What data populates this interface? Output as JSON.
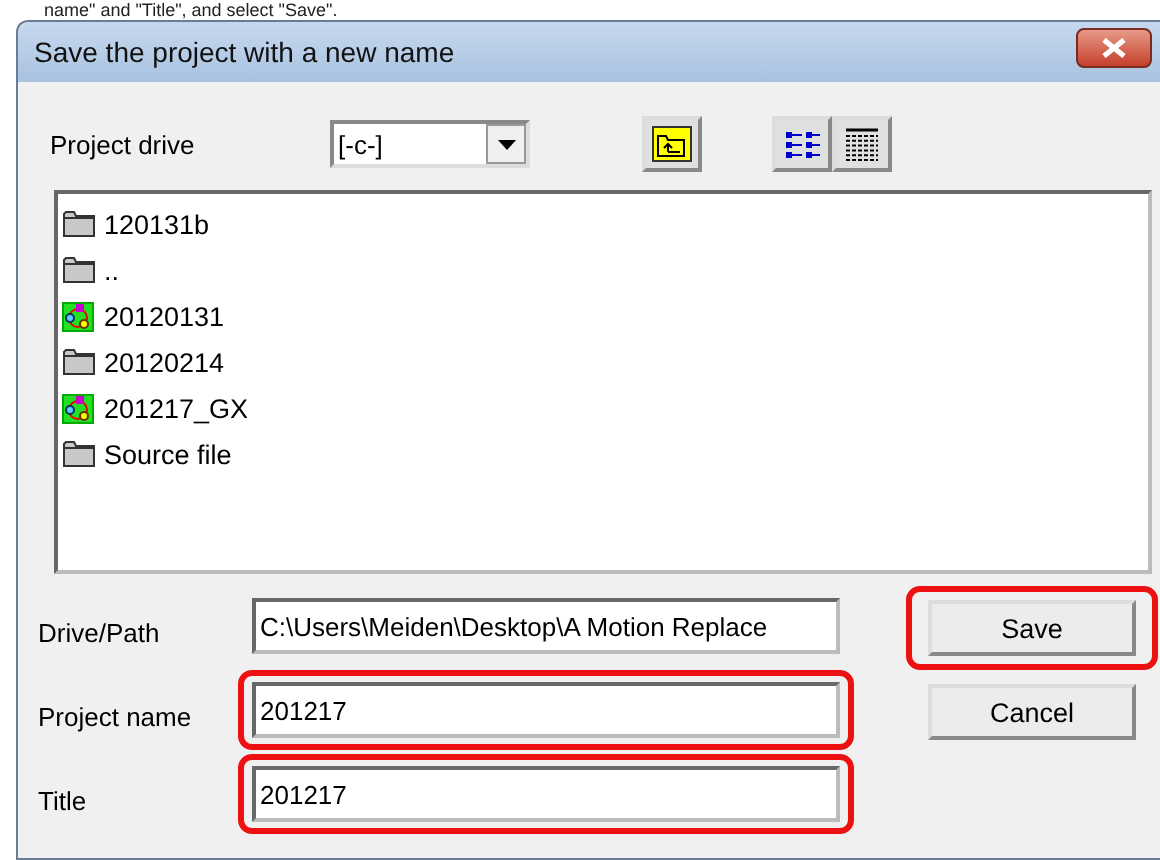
{
  "caption": "name\" and \"Title\", and select \"Save\".",
  "window": {
    "title": "Save the project with a new name"
  },
  "drive": {
    "label": "Project drive",
    "value": "[-c-]"
  },
  "files": [
    {
      "name": "120131b",
      "kind": "folder"
    },
    {
      "name": "..",
      "kind": "folder"
    },
    {
      "name": "20120131",
      "kind": "project"
    },
    {
      "name": "20120214",
      "kind": "folder"
    },
    {
      "name": "201217_GX",
      "kind": "project"
    },
    {
      "name": "Source file",
      "kind": "folder"
    }
  ],
  "fields": [
    {
      "label": "Drive/Path",
      "value": "C:\\Users\\Meiden\\Desktop\\A Motion Replace",
      "highlighted": false
    },
    {
      "label": "Project name",
      "value": "201217",
      "highlighted": true
    },
    {
      "label": "Title",
      "value": "201217",
      "highlighted": true
    }
  ],
  "buttons": [
    {
      "label": "Save",
      "highlighted": true
    },
    {
      "label": "Cancel",
      "highlighted": false
    }
  ]
}
